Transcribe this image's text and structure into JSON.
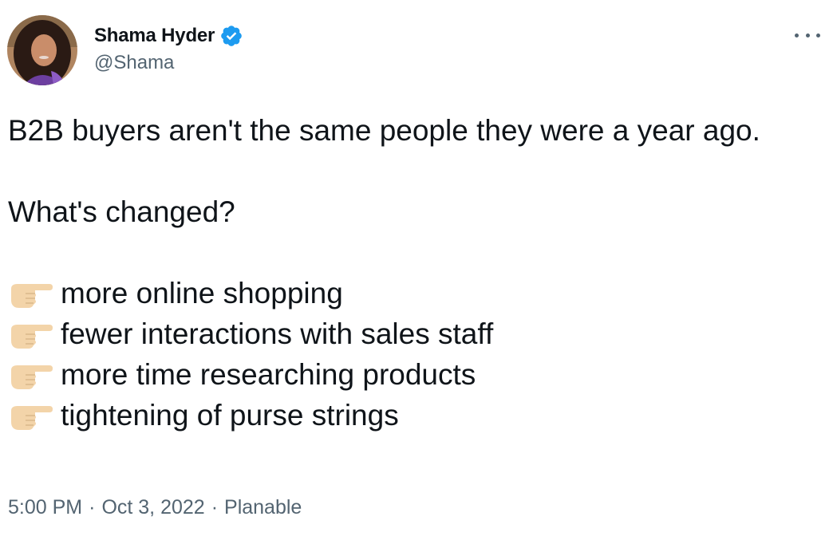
{
  "author": {
    "display_name": "Shama Hyder",
    "handle": "@Shama",
    "verified": true,
    "avatar_icon": "profile-photo"
  },
  "menu": {
    "icon": "more-options-icon"
  },
  "tweet": {
    "line1": "B2B buyers aren't the same people they were a year ago.",
    "line2": "What's changed?",
    "bullet_icon": "backhand-index-pointing-right-emoji",
    "bullets": [
      "more online shopping",
      "fewer interactions with sales staff",
      "more time researching products",
      "tightening of purse strings"
    ]
  },
  "meta": {
    "time": "5:00 PM",
    "separator": "·",
    "date": "Oct 3, 2022",
    "source": "Planable"
  },
  "colors": {
    "text": "#0f1419",
    "secondary": "#536471",
    "verified": "#1d9bf0",
    "emoji_skin": "#f3d4a9"
  }
}
